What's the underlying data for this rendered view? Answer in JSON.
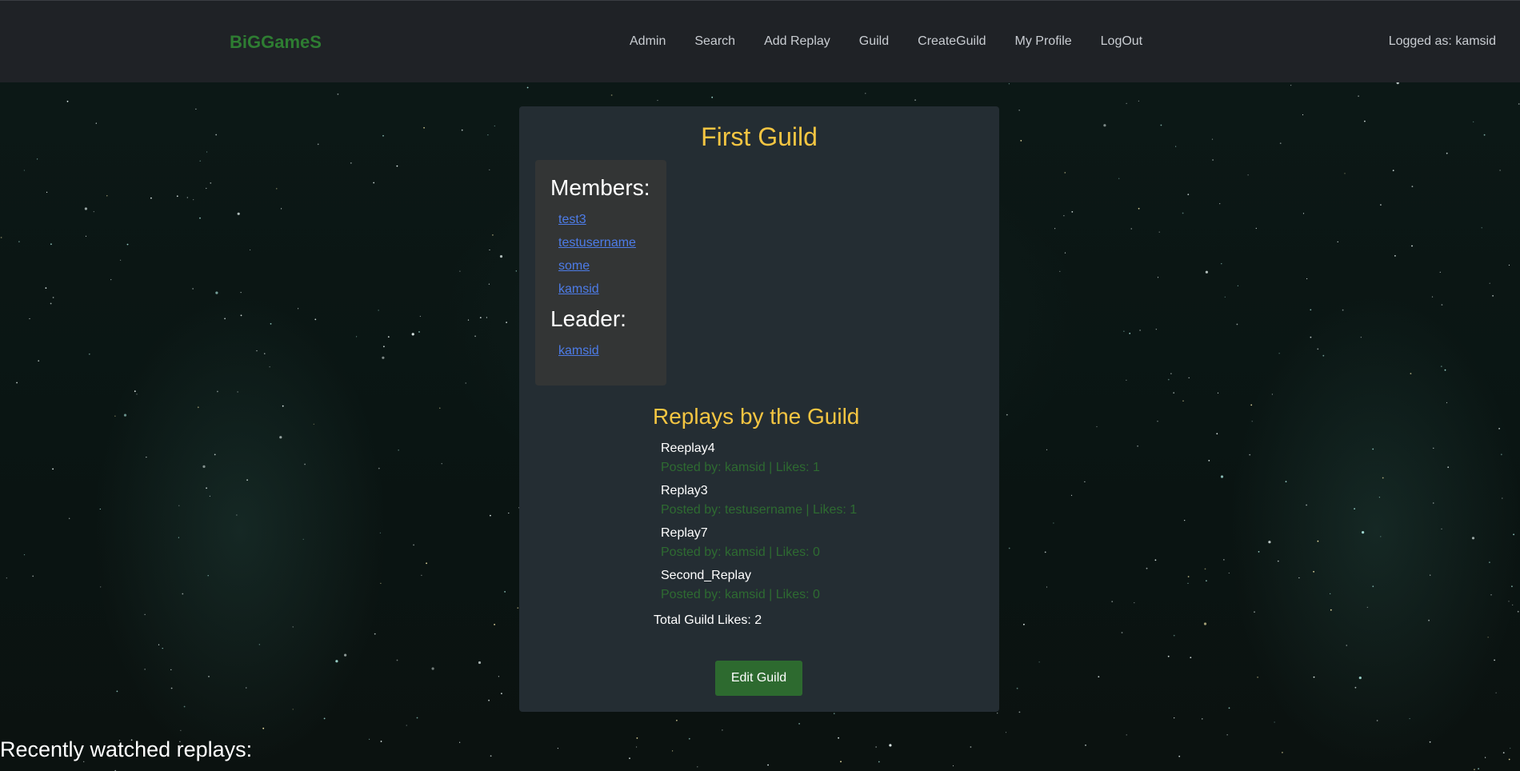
{
  "header": {
    "brand": "BiGGameS",
    "nav": [
      "Admin",
      "Search",
      "Add Replay",
      "Guild",
      "CreateGuild",
      "My Profile",
      "LogOut"
    ],
    "logged_as": "Logged as: kamsid"
  },
  "guild": {
    "name": "First Guild",
    "members_heading": "Members:",
    "members": [
      "test3",
      "testusername",
      "some",
      "kamsid"
    ],
    "leader_heading": "Leader:",
    "leader": "kamsid",
    "replays_heading": "Replays by the Guild",
    "replays": [
      {
        "name": "Reeplay4",
        "meta": "Posted by: kamsid | Likes: 1"
      },
      {
        "name": "Replay3",
        "meta": "Posted by: testusername | Likes: 1"
      },
      {
        "name": "Replay7",
        "meta": "Posted by: kamsid | Likes: 0"
      },
      {
        "name": "Second_Replay",
        "meta": "Posted by: kamsid | Likes: 0"
      }
    ],
    "total_likes_label": "Total Guild Likes: 2",
    "edit_button": "Edit Guild"
  },
  "recent_heading": "Recently watched replays:",
  "colors": {
    "brand": "#2e7d32",
    "title": "#f4c542",
    "link": "#4d7ce8",
    "button": "#2d6a2f",
    "meta": "#2e6b31"
  }
}
